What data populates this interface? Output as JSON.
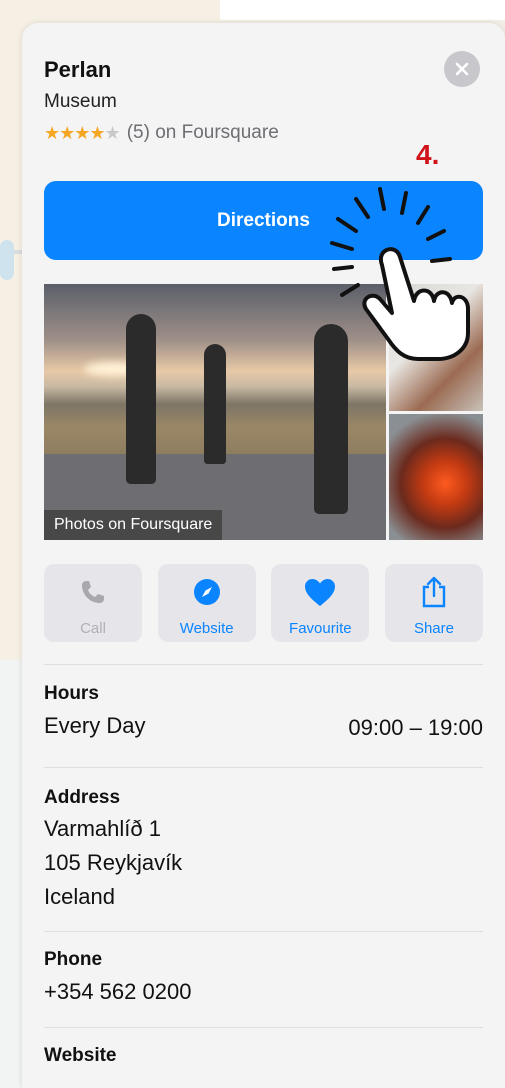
{
  "place": {
    "name": "Perlan",
    "category": "Museum",
    "stars_filled": "★★★★",
    "stars_empty": "★",
    "rating_text": "(5) on Foursquare",
    "rating_value": 4,
    "rating_max": 5
  },
  "step_label": "4.",
  "directions_label": "Directions",
  "photos": {
    "caption": "Photos on Foursquare"
  },
  "actions": [
    {
      "label": "Call",
      "icon": "phone-icon",
      "enabled": false
    },
    {
      "label": "Website",
      "icon": "compass-icon",
      "enabled": true
    },
    {
      "label": "Favourite",
      "icon": "heart-icon",
      "enabled": true
    },
    {
      "label": "Share",
      "icon": "share-icon",
      "enabled": true
    }
  ],
  "hours": {
    "title": "Hours",
    "day": "Every Day",
    "time": "09:00 – 19:00"
  },
  "address": {
    "title": "Address",
    "line1": "Varmahlíð 1",
    "line2": "105 Reykjavík",
    "line3": "Iceland"
  },
  "phone": {
    "title": "Phone",
    "number": "+354 562 0200"
  },
  "website": {
    "title": "Website"
  },
  "colors": {
    "accent": "#0a84ff",
    "star": "#f5a623",
    "step_label": "#d0121b",
    "card_bg": "#f4f4f5"
  }
}
